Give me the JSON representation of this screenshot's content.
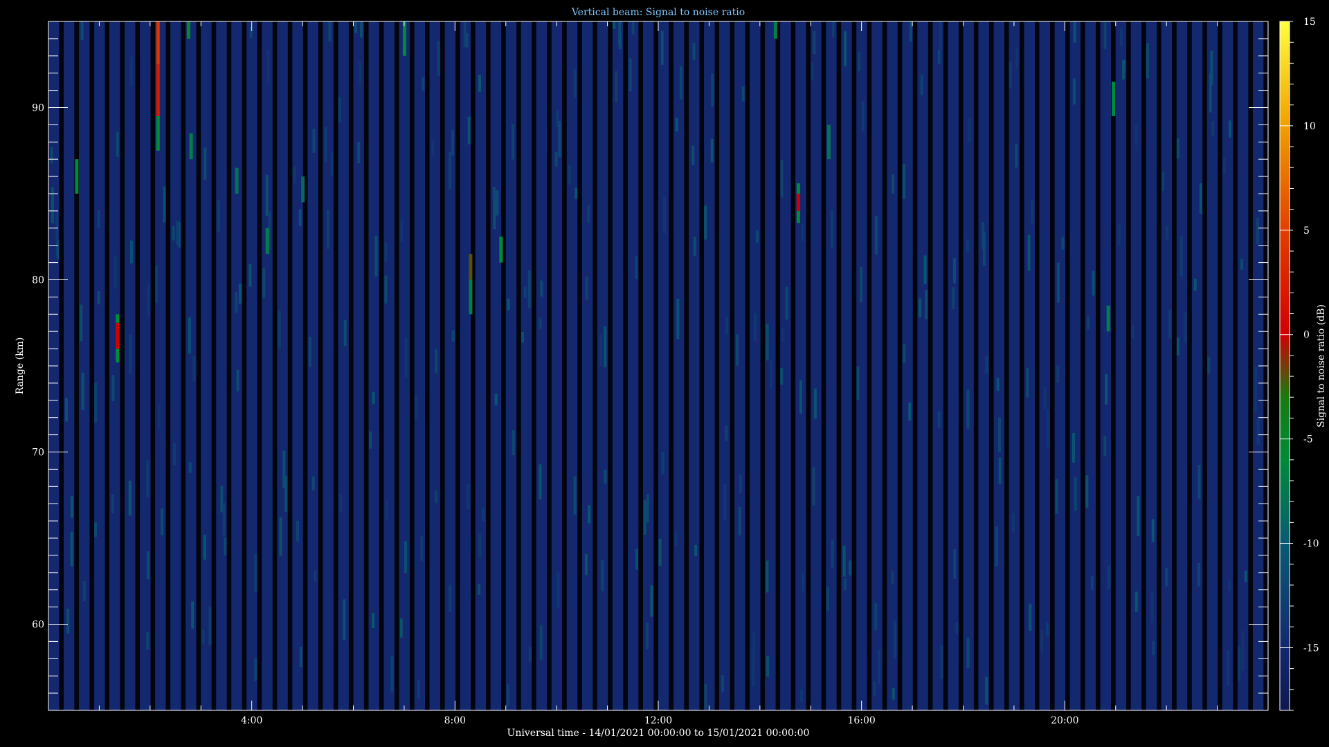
{
  "chart_data": {
    "type": "heatmap",
    "title": "Vertical beam: Signal to noise ratio",
    "xlabel": "Universal time - 14/01/2021 00:00:00 to 15/01/2021 00:00:00",
    "ylabel": "Range (km)",
    "x_unit": "hours UT",
    "xlim": [
      0,
      24
    ],
    "ylim": [
      55,
      95
    ],
    "x_ticks": [
      {
        "value": 4,
        "label": "4:00"
      },
      {
        "value": 8,
        "label": "8:00"
      },
      {
        "value": 12,
        "label": "12:00"
      },
      {
        "value": 16,
        "label": "16:00"
      },
      {
        "value": 20,
        "label": "20:00"
      }
    ],
    "y_ticks": [
      {
        "value": 60,
        "label": "60"
      },
      {
        "value": 70,
        "label": "70"
      },
      {
        "value": 80,
        "label": "80"
      },
      {
        "value": 90,
        "label": "90"
      }
    ],
    "colorbar": {
      "label": "Signal to noise ratio (dB)",
      "range": [
        -18,
        15
      ],
      "ticks": [
        {
          "value": 15,
          "label": "15"
        },
        {
          "value": 10,
          "label": "10"
        },
        {
          "value": 5,
          "label": "5"
        },
        {
          "value": 0,
          "label": "0"
        },
        {
          "value": -5,
          "label": "-5"
        },
        {
          "value": -10,
          "label": "-10"
        },
        {
          "value": -15,
          "label": "-15"
        }
      ],
      "colormap": [
        {
          "value": -18,
          "color": "#0e1850"
        },
        {
          "value": -15,
          "color": "#142870"
        },
        {
          "value": -10,
          "color": "#0a5a72"
        },
        {
          "value": -6,
          "color": "#008a3a"
        },
        {
          "value": -3,
          "color": "#1a7a10"
        },
        {
          "value": 0,
          "color": "#d00000"
        },
        {
          "value": 5,
          "color": "#e04000"
        },
        {
          "value": 10,
          "color": "#f0a000"
        },
        {
          "value": 15,
          "color": "#ffff40"
        }
      ]
    },
    "background_level_db": -16,
    "time_step_hours": 0.3,
    "data_gap_fraction": 0.3,
    "features": [
      {
        "time": 0.55,
        "range_start": 85.0,
        "range_end": 87.0,
        "snr": -6
      },
      {
        "time": 1.35,
        "range_start": 75.2,
        "range_end": 76.0,
        "snr": -6
      },
      {
        "time": 1.35,
        "range_start": 76.0,
        "range_end": 77.5,
        "snr": 0
      },
      {
        "time": 1.35,
        "range_start": 77.5,
        "range_end": 78.0,
        "snr": -6
      },
      {
        "time": 2.15,
        "range_start": 87.5,
        "range_end": 89.5,
        "snr": -6
      },
      {
        "time": 2.15,
        "range_start": 89.5,
        "range_end": 92.5,
        "snr": 2
      },
      {
        "time": 2.15,
        "range_start": 92.5,
        "range_end": 95.0,
        "snr": 4
      },
      {
        "time": 2.75,
        "range_start": 94.0,
        "range_end": 95.0,
        "snr": -5
      },
      {
        "time": 2.8,
        "range_start": 87.0,
        "range_end": 88.5,
        "snr": -7
      },
      {
        "time": 3.7,
        "range_start": 85.0,
        "range_end": 86.5,
        "snr": -8
      },
      {
        "time": 4.3,
        "range_start": 81.5,
        "range_end": 83.0,
        "snr": -7
      },
      {
        "time": 5.0,
        "range_start": 84.5,
        "range_end": 86.0,
        "snr": -9
      },
      {
        "time": 7.0,
        "range_start": 93.0,
        "range_end": 95.0,
        "snr": -6
      },
      {
        "time": 8.3,
        "range_start": 78.0,
        "range_end": 80.0,
        "snr": -7
      },
      {
        "time": 8.3,
        "range_start": 80.0,
        "range_end": 81.5,
        "snr": -2
      },
      {
        "time": 8.9,
        "range_start": 81.0,
        "range_end": 82.5,
        "snr": -6
      },
      {
        "time": 14.3,
        "range_start": 94.0,
        "range_end": 95.0,
        "snr": -7
      },
      {
        "time": 14.75,
        "range_start": 83.3,
        "range_end": 84.0,
        "snr": -6
      },
      {
        "time": 14.75,
        "range_start": 84.0,
        "range_end": 85.0,
        "snr": 0
      },
      {
        "time": 14.75,
        "range_start": 85.0,
        "range_end": 85.6,
        "snr": -6
      },
      {
        "time": 15.35,
        "range_start": 87.0,
        "range_end": 89.0,
        "snr": -8
      },
      {
        "time": 20.85,
        "range_start": 77.0,
        "range_end": 78.5,
        "snr": -7
      },
      {
        "time": 20.95,
        "range_start": 89.5,
        "range_end": 91.5,
        "snr": -6
      }
    ]
  }
}
